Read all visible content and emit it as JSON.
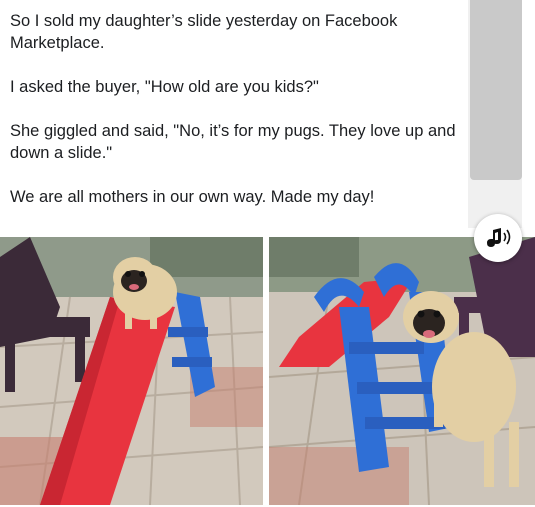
{
  "post": {
    "line1": "So I sold my daughter’s slide yesterday on Facebook Marketplace.",
    "line2": "I asked the buyer, \"How old are you kids?\"",
    "line3": "She giggled and said, \"No, it’s for my pugs. They love up and down a slide.\"",
    "line4": "We are all mothers in our own way. Made my day!"
  },
  "images": {
    "left": "pug-on-slide-photo",
    "right": "pug-on-ladder-photo"
  },
  "controls": {
    "audio_icon": "speaker-sound-icon"
  },
  "colors": {
    "slide_red": "#e8343f",
    "slide_blue": "#2f6fd6",
    "pug_fawn": "#e3cfa4",
    "chair": "#3b2a38"
  }
}
